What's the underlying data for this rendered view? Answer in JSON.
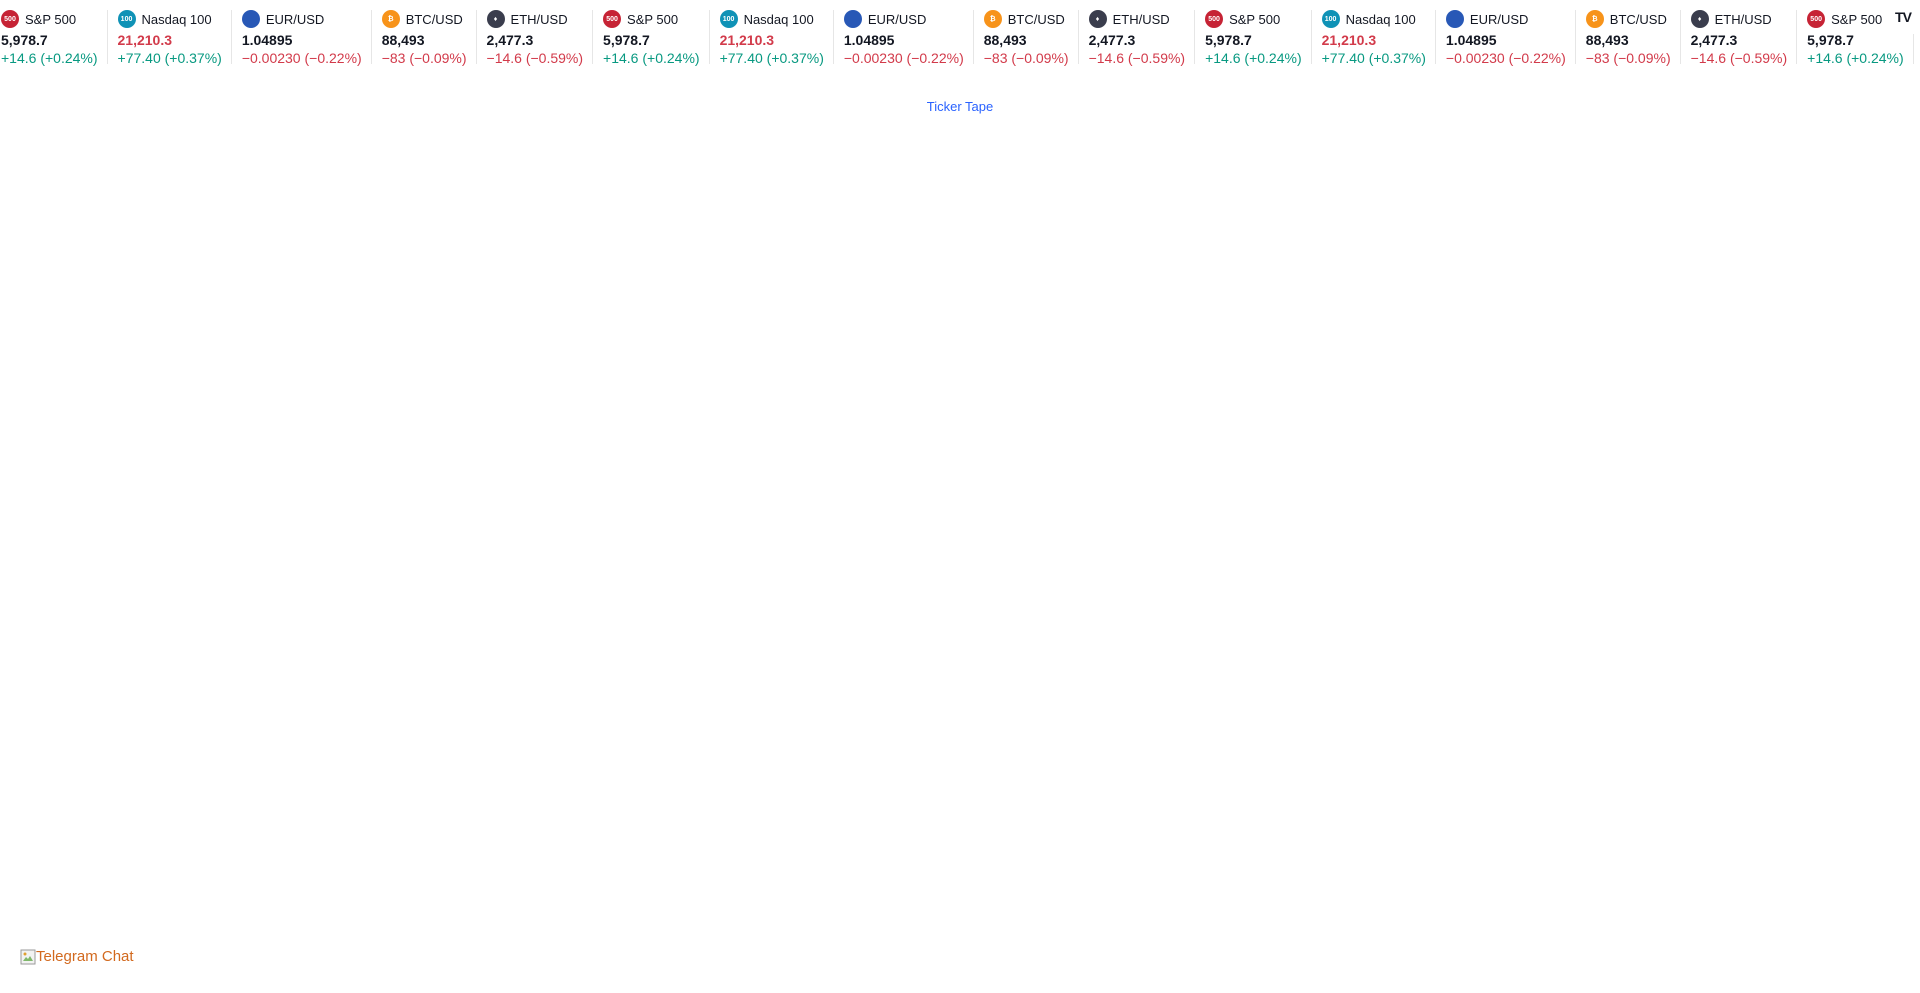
{
  "colors": {
    "up": "#089981",
    "down": "#d23a4a",
    "price_down": "#d23a4a",
    "price_neutral": "#131722",
    "link": "#2962ff",
    "telegram_text": "#d2691e"
  },
  "ticker": {
    "symbols": [
      {
        "name": "S&P 500",
        "logo_icon": "sp500-logo-icon",
        "logo_text": "500",
        "logo_color": "#c62335",
        "price": "5,978.7",
        "price_trend": "neutral",
        "change": "+14.6 (+0.24%)",
        "change_trend": "up"
      },
      {
        "name": "Nasdaq 100",
        "logo_icon": "nasdaq100-logo-icon",
        "logo_text": "100",
        "logo_color": "#0f92b6",
        "price": "21,210.3",
        "price_trend": "down",
        "change": "+77.40 (+0.37%)",
        "change_trend": "up"
      },
      {
        "name": "EUR/USD",
        "logo_icon": "eur-usd-flags-icon",
        "logo_text": "",
        "logo_color": "#2858b6",
        "price": "1.04895",
        "price_trend": "neutral",
        "change": "−0.00230 (−0.22%)",
        "change_trend": "down"
      },
      {
        "name": "BTC/USD",
        "logo_icon": "bitcoin-logo-icon",
        "logo_text": "₿",
        "logo_color": "#f7931a",
        "price": "88,493",
        "price_trend": "neutral",
        "change": "−83 (−0.09%)",
        "change_trend": "down"
      },
      {
        "name": "ETH/USD",
        "logo_icon": "ethereum-logo-icon",
        "logo_text": "♦",
        "logo_color": "#3a3d4d",
        "price": "2,477.3",
        "price_trend": "neutral",
        "change": "−14.6 (−0.59%)",
        "change_trend": "down"
      }
    ],
    "repeat_count": 4,
    "brand_icon": "tradingview-logo-icon",
    "brand_label": "TV",
    "caption_link": "Ticker Tape"
  },
  "telegram": {
    "alt_text": "Telegram Chat",
    "icon": "broken-image-icon"
  }
}
